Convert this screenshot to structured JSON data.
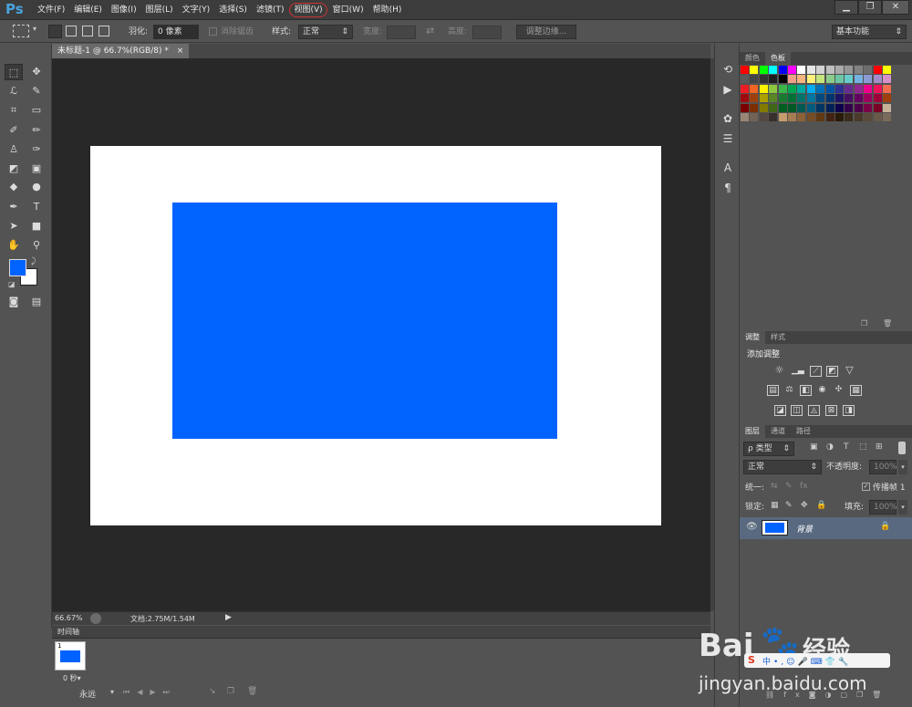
{
  "app": {
    "logo": "Ps"
  },
  "menu": {
    "items": [
      "文件(F)",
      "编辑(E)",
      "图像(I)",
      "图层(L)",
      "文字(Y)",
      "选择(S)",
      "滤镜(T)",
      "视图(V)",
      "窗口(W)",
      "帮助(H)"
    ],
    "highlighted": "视图(V)"
  },
  "window_buttons": {
    "minimize": "▁",
    "restore": "❐",
    "close": "✕"
  },
  "options": {
    "feather_label": "羽化:",
    "feather_value": "0 像素",
    "antialias_label": "消除锯齿",
    "style_label": "样式:",
    "style_value": "正常",
    "width_label": "宽度:",
    "height_label": "高度:",
    "refine_edge": "调整边缘...",
    "workspace": "基本功能"
  },
  "document": {
    "tab_title": "未标题-1 @ 66.7%(RGB/8) *",
    "tab_close": "×",
    "rect_color": "#0063ff"
  },
  "status": {
    "zoom": "66.67%",
    "doc_info": "文档:2.75M/1.54M"
  },
  "timeline": {
    "title": "时间轴",
    "frame_number": "1",
    "frame_delay": "0 秒▾",
    "loop": "永远"
  },
  "swatches_panel": {
    "tabs": [
      "颜色",
      "色板"
    ],
    "active_tab": "色板"
  },
  "adjustments_panel": {
    "tabs": [
      "调整",
      "样式"
    ],
    "active_tab": "调整",
    "title": "添加调整"
  },
  "layers_panel": {
    "tabs": [
      "图层",
      "通道",
      "路径"
    ],
    "active_tab": "图层",
    "filter_kind": "ρ 类型",
    "blend_mode": "正常",
    "opacity_label": "不透明度:",
    "opacity_value": "100%",
    "unify_label": "统一:",
    "propagate_label": "传播帧 1",
    "lock_label": "锁定:",
    "fill_label": "填充:",
    "fill_value": "100%",
    "layers": [
      {
        "name": "背景",
        "locked": true
      }
    ]
  },
  "colors": {
    "foreground": "#0063ff",
    "background": "#ffffff",
    "accent_highlight": "#cc3333"
  },
  "watermark": {
    "brand": "Bai",
    "paw": "🐾",
    "tail": "经验",
    "url": "jingyan.baidu.com"
  }
}
